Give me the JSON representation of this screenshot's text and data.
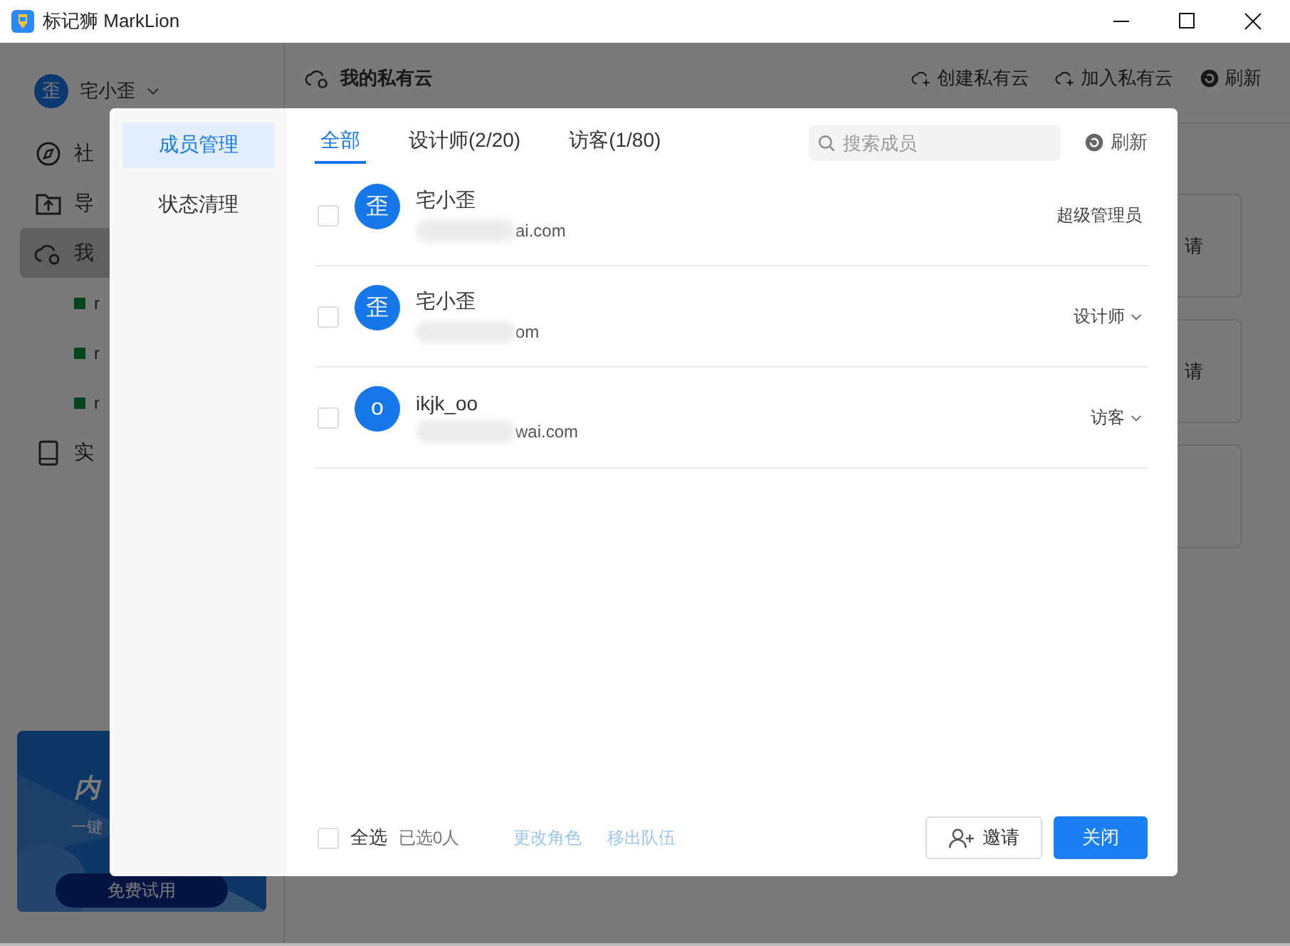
{
  "window": {
    "title": "标记狮 MarkLion"
  },
  "user": {
    "avatar": "歪",
    "name": "宅小歪"
  },
  "sidebar": {
    "items": [
      {
        "kind": "community",
        "label": "社",
        "selected": false
      },
      {
        "kind": "export",
        "label": "导",
        "selected": false
      },
      {
        "kind": "cloud",
        "label": "我",
        "selected": true
      },
      {
        "kind": "project",
        "label": "r",
        "selected": false
      },
      {
        "kind": "project",
        "label": "r",
        "selected": false
      },
      {
        "kind": "project",
        "label": "r",
        "selected": false
      },
      {
        "kind": "device",
        "label": "实",
        "selected": false
      }
    ]
  },
  "banner": {
    "line_1": "内",
    "line_2": "一键",
    "button": "免费试用"
  },
  "header": {
    "title": "我的私有云",
    "actions": [
      {
        "kind": "create",
        "label": "创建私有云"
      },
      {
        "kind": "join",
        "label": "加入私有云"
      },
      {
        "kind": "refresh",
        "label": "刷新"
      }
    ]
  },
  "cards": [
    {
      "text": "请"
    },
    {
      "text": "请"
    }
  ],
  "dialog": {
    "nav": [
      {
        "label": "成员管理",
        "selected": true
      },
      {
        "label": "状态清理",
        "selected": false
      }
    ],
    "tabs": [
      {
        "label": "全部",
        "selected": true
      },
      {
        "label": "设计师(2/20)",
        "selected": false
      },
      {
        "label": "访客(1/80)",
        "selected": false
      }
    ],
    "search": {
      "placeholder": "搜索成员"
    },
    "refresh": "刷新",
    "members": [
      {
        "avatar": "歪",
        "name": "宅小歪",
        "email": "ai.com",
        "role": "超级管理员",
        "dropdown": false,
        "checked": false
      },
      {
        "avatar": "歪",
        "name": "宅小歪",
        "email": "om",
        "role": "设计师",
        "dropdown": true,
        "checked": false
      },
      {
        "avatar": "o",
        "name": "ikjk_oo",
        "email": "wai.com",
        "role": "访客",
        "dropdown": true,
        "checked": false
      }
    ],
    "footer": {
      "select_all": {
        "label": "全选",
        "checked": false
      },
      "selected_count": "已选0人",
      "links": [
        {
          "label": "更改角色",
          "disabled": true
        },
        {
          "label": "移出队伍",
          "disabled": true
        }
      ],
      "invite": "邀请",
      "close": "关闭"
    }
  }
}
